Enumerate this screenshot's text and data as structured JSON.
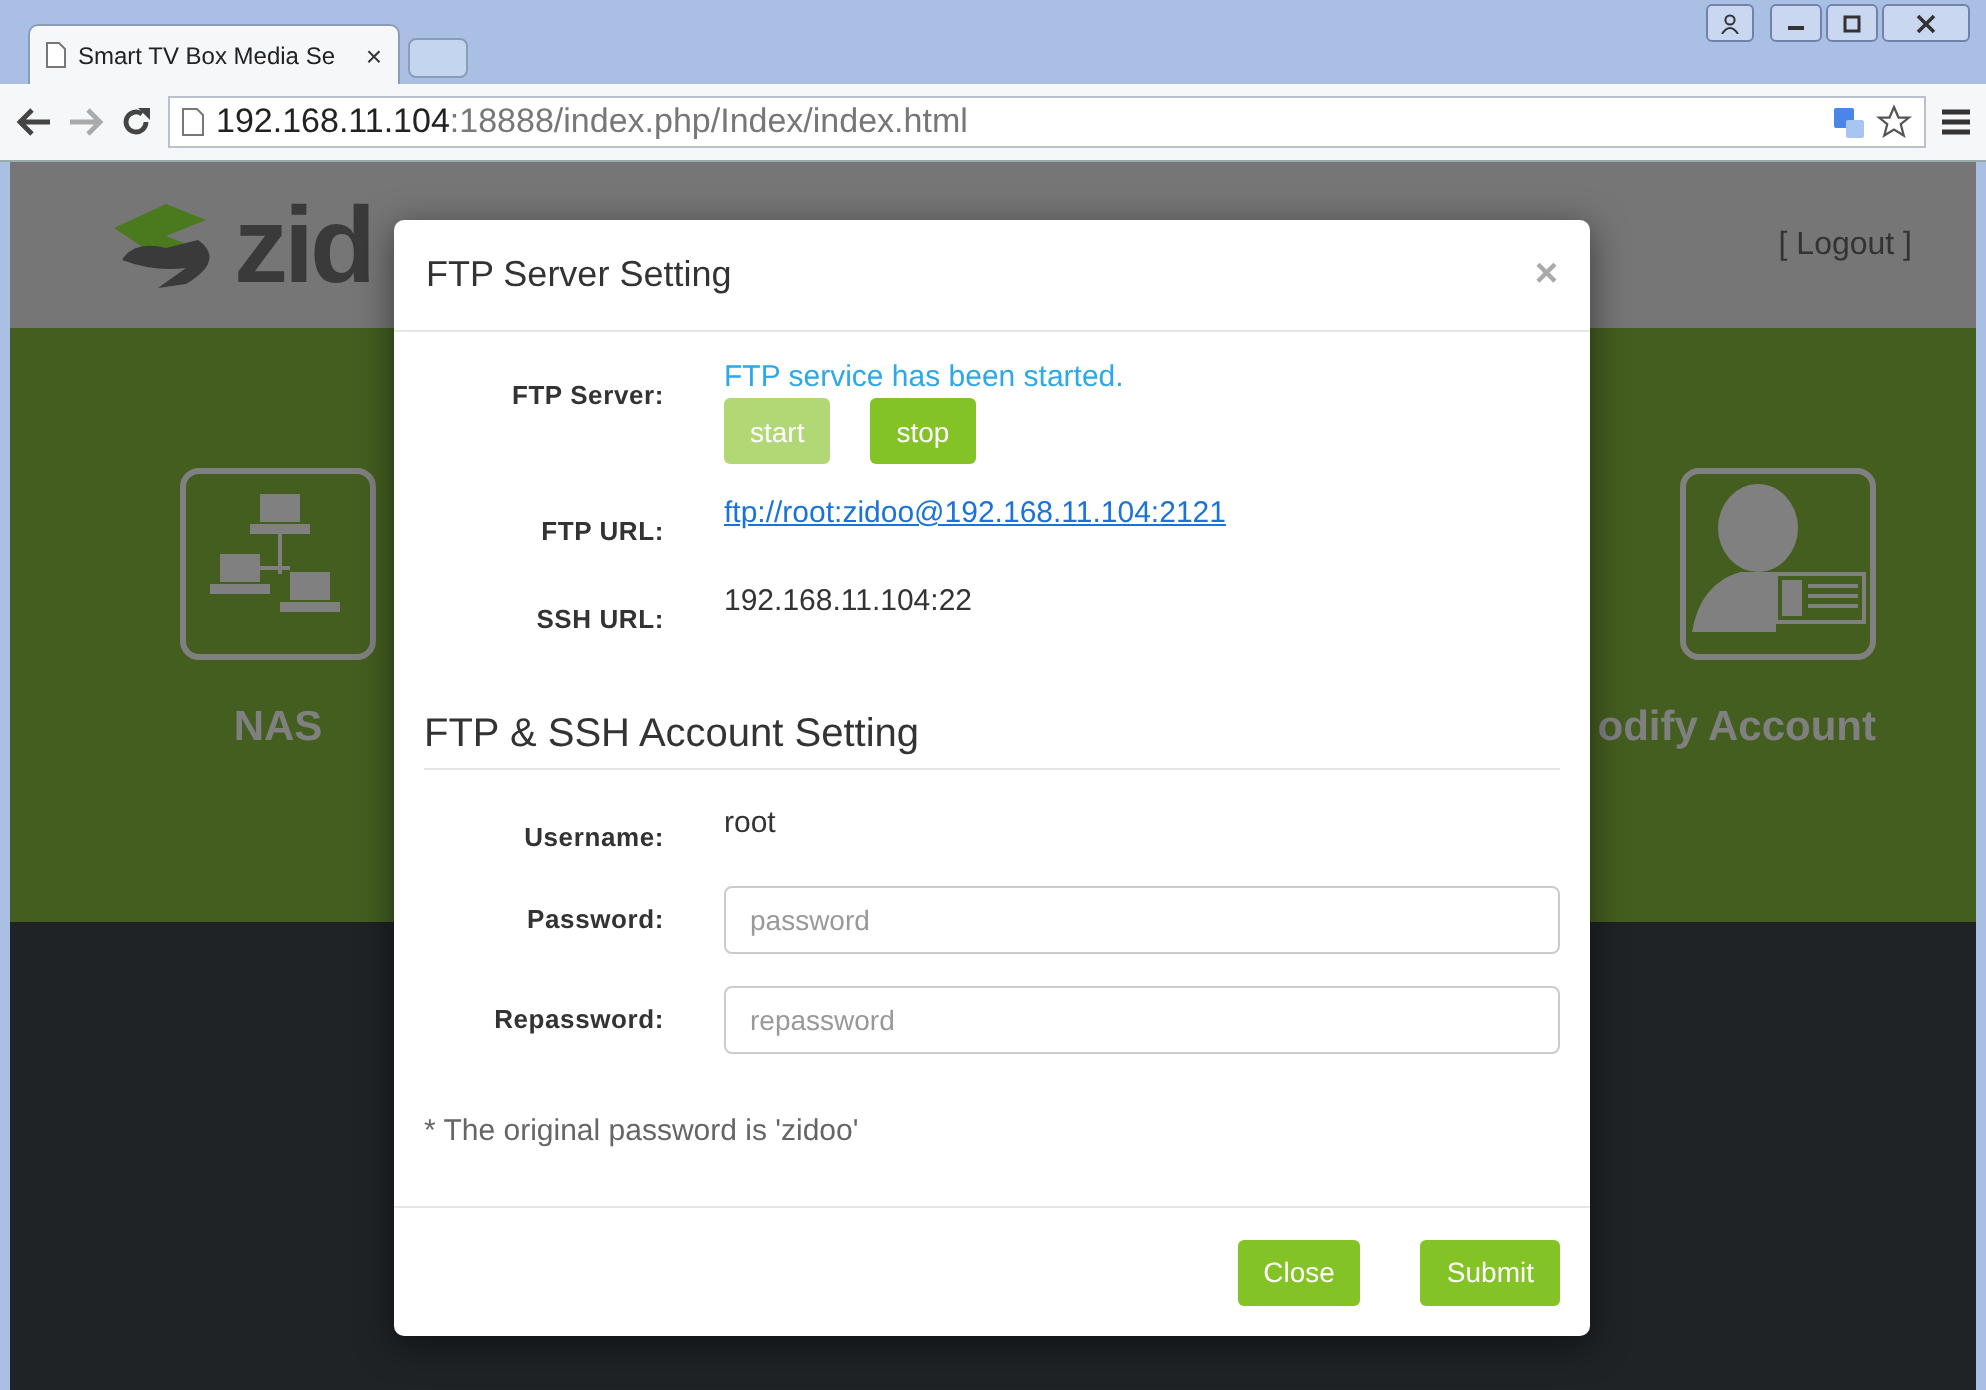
{
  "browser": {
    "tab_title": "Smart TV Box Media Se",
    "tab_close": "×",
    "url_host": "192.168.11.104",
    "url_rest": ":18888/index.php/Index/index.html"
  },
  "header": {
    "logo_text": "zid",
    "logout": "[ Logout ]"
  },
  "tiles": [
    {
      "label": "NAS",
      "kind": "network"
    },
    {
      "label": "odify Account",
      "kind": "account"
    }
  ],
  "modal": {
    "title": "FTP Server Setting",
    "close": "×",
    "server_label": "FTP Server:",
    "server_status": "FTP service has been started.",
    "buttons": [
      {
        "label": "start",
        "disabled": true
      },
      {
        "label": "stop",
        "disabled": false
      }
    ],
    "ftp_url_label": "FTP URL:",
    "ftp_url": "ftp://root:zidoo@192.168.11.104:2121",
    "ssh_url_label": "SSH URL:",
    "ssh_url": "192.168.11.104:22",
    "account_heading": "FTP & SSH Account Setting",
    "username_label": "Username:",
    "username": "root",
    "password_label": "Password:",
    "password_placeholder": "password",
    "repassword_label": "Repassword:",
    "repassword_placeholder": "repassword",
    "note": "*  The original password is 'zidoo'",
    "footer_buttons": [
      "Close",
      "Submit"
    ]
  }
}
